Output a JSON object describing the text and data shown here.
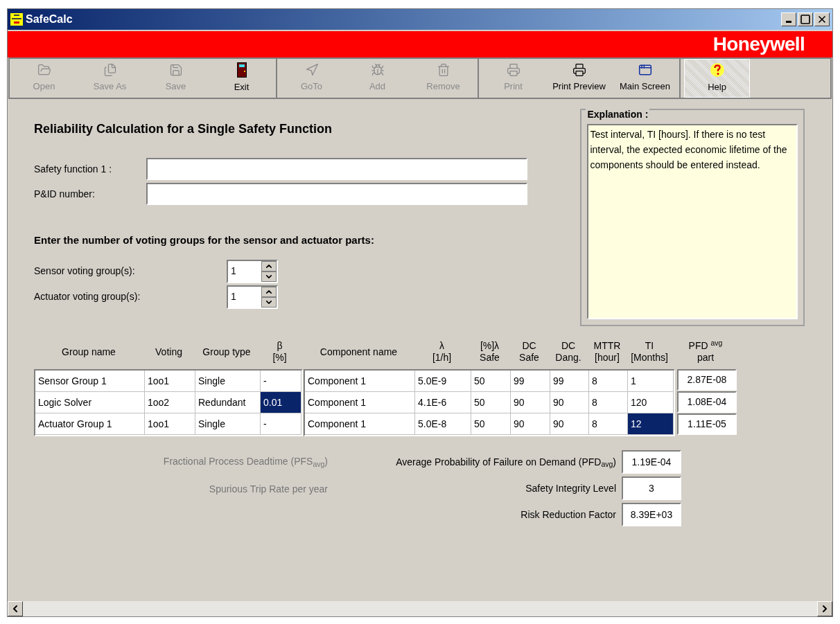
{
  "window": {
    "title": "SafeCalc"
  },
  "brand": "Honeywell",
  "toolbar": {
    "groups": [
      [
        {
          "label": "Open",
          "kind": "open",
          "disabled": true
        },
        {
          "label": "Save As",
          "kind": "save_as",
          "disabled": true
        },
        {
          "label": "Save",
          "kind": "save",
          "disabled": true
        },
        {
          "label": "Exit",
          "kind": "exit",
          "disabled": false
        }
      ],
      [
        {
          "label": "GoTo",
          "kind": "goto",
          "disabled": true
        },
        {
          "label": "Add",
          "kind": "add",
          "disabled": true
        },
        {
          "label": "Remove",
          "kind": "remove",
          "disabled": true
        }
      ],
      [
        {
          "label": "Print",
          "kind": "print",
          "disabled": true
        },
        {
          "label": "Print Preview",
          "kind": "preview",
          "disabled": false
        },
        {
          "label": "Main Screen",
          "kind": "main",
          "disabled": false
        }
      ],
      [
        {
          "label": "Help",
          "kind": "help",
          "disabled": false,
          "pressed": true
        }
      ]
    ]
  },
  "heading": "Reliability Calculation for a Single Safety Function",
  "fields": [
    {
      "label": "Safety function  1 :"
    },
    {
      "label": "P&ID number:"
    }
  ],
  "voting_heading": "Enter the number of voting groups for the sensor and actuator parts:",
  "spinners": [
    {
      "label": "Sensor voting group(s):",
      "value": "1"
    },
    {
      "label": "Actuator voting group(s):",
      "value": "1"
    }
  ],
  "explanation": {
    "title": "Explanation :",
    "text": "Test interval, TI [hours]. If there is no test interval, the expected economic lifetime of the components should be entered instead."
  },
  "table": {
    "columns": [
      {
        "lines": [
          "Group name"
        ]
      },
      {
        "lines": [
          "Voting"
        ]
      },
      {
        "lines": [
          "Group type"
        ]
      },
      {
        "lines": [
          "β",
          "[%]"
        ]
      },
      {
        "lines": [
          "Component name"
        ]
      },
      {
        "lines": [
          "λ",
          "[1/h]"
        ]
      },
      {
        "lines": [
          "[%]λ",
          "Safe"
        ]
      },
      {
        "lines": [
          "DC",
          "Safe"
        ]
      },
      {
        "lines": [
          "DC",
          "Dang."
        ]
      },
      {
        "lines": [
          "MTTR",
          "[hour]"
        ]
      },
      {
        "lines": [
          "TI",
          "[Months]"
        ]
      },
      {
        "lines": [
          "PFD $^{avg}$",
          "part"
        ]
      }
    ],
    "rows": [
      {
        "cells": [
          {
            "text": "Sensor Group 1",
            "selected": false
          },
          {
            "text": "1oo1",
            "selected": false
          },
          {
            "text": "Single",
            "selected": false
          },
          {
            "text": "-",
            "selected": false
          },
          {
            "text": "Component 1",
            "selected": false
          },
          {
            "text": "5.0E-9",
            "selected": false
          },
          {
            "text": "50",
            "selected": false
          },
          {
            "text": "99",
            "selected": false
          },
          {
            "text": "99",
            "selected": false
          },
          {
            "text": "8",
            "selected": false
          },
          {
            "text": "1",
            "selected": false
          },
          {
            "text": "2.87E-08",
            "selected": false
          }
        ]
      },
      {
        "cells": [
          {
            "text": "Logic Solver",
            "selected": false
          },
          {
            "text": "1oo2",
            "selected": false
          },
          {
            "text": "Redundant",
            "selected": false
          },
          {
            "text": "0.01",
            "selected": true
          },
          {
            "text": "Component 1",
            "selected": false
          },
          {
            "text": "4.1E-6",
            "selected": false
          },
          {
            "text": "50",
            "selected": false
          },
          {
            "text": "90",
            "selected": false
          },
          {
            "text": "90",
            "selected": false
          },
          {
            "text": "8",
            "selected": false
          },
          {
            "text": "120",
            "selected": false
          },
          {
            "text": "1.08E-04",
            "selected": false
          }
        ]
      },
      {
        "cells": [
          {
            "text": "Actuator Group 1",
            "selected": false
          },
          {
            "text": "1oo1",
            "selected": false
          },
          {
            "text": "Single",
            "selected": false
          },
          {
            "text": "-",
            "selected": false
          },
          {
            "text": "Component 1",
            "selected": false
          },
          {
            "text": "5.0E-8",
            "selected": false
          },
          {
            "text": "50",
            "selected": false
          },
          {
            "text": "90",
            "selected": false
          },
          {
            "text": "90",
            "selected": false
          },
          {
            "text": "8",
            "selected": false
          },
          {
            "text": "12",
            "selected": true
          },
          {
            "text": "1.11E-05",
            "selected": false
          }
        ]
      }
    ]
  },
  "left_results": [
    {
      "label": "Fractional Process Deadtime   (PFS$_{avg}$)",
      "disabled": true
    },
    {
      "label": "Spurious Trip Rate per year",
      "disabled": true
    }
  ],
  "results": [
    {
      "label": "Average Probability of Failure on Demand (PFD$_{avg}$)",
      "value": "1.19E-04"
    },
    {
      "label": "Safety Integrity Level",
      "value": "3"
    },
    {
      "label": "Risk Reduction Factor",
      "value": "8.39E+03"
    }
  ]
}
